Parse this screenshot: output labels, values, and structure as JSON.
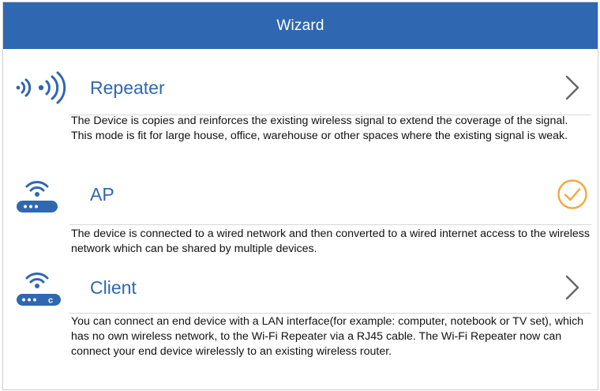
{
  "header": {
    "title": "Wizard"
  },
  "options": [
    {
      "title": "Repeater",
      "icon": "repeater-signal-icon",
      "action": "chevron-right-icon",
      "description": "The Device is copies and reinforces the existing wireless signal to extend the coverage of the signal. This mode is fit for large house, office, warehouse or other spaces where the existing signal is weak.",
      "selected": false
    },
    {
      "title": "AP",
      "icon": "router-wifi-icon",
      "action": "check-circle-icon",
      "description": "The device is connected to a wired network and then converted to a wired internet access to the wireless network which can be shared by multiple devices.",
      "selected": true
    },
    {
      "title": "Client",
      "icon": "router-client-icon",
      "action": "chevron-right-icon",
      "router_badge": "c",
      "description": "You can connect an end device with a LAN interface(for example: computer, notebook or TV set), which has no own wireless network, to the Wi-Fi Repeater via a RJ45 cable. The Wi-Fi Repeater now can connect your end device wirelessly to an existing wireless router.",
      "selected": false
    }
  ],
  "colors": {
    "header_bg": "#2f67b1",
    "accent": "#2f67b1",
    "selected": "#f4a73a",
    "chevron": "#666666"
  }
}
